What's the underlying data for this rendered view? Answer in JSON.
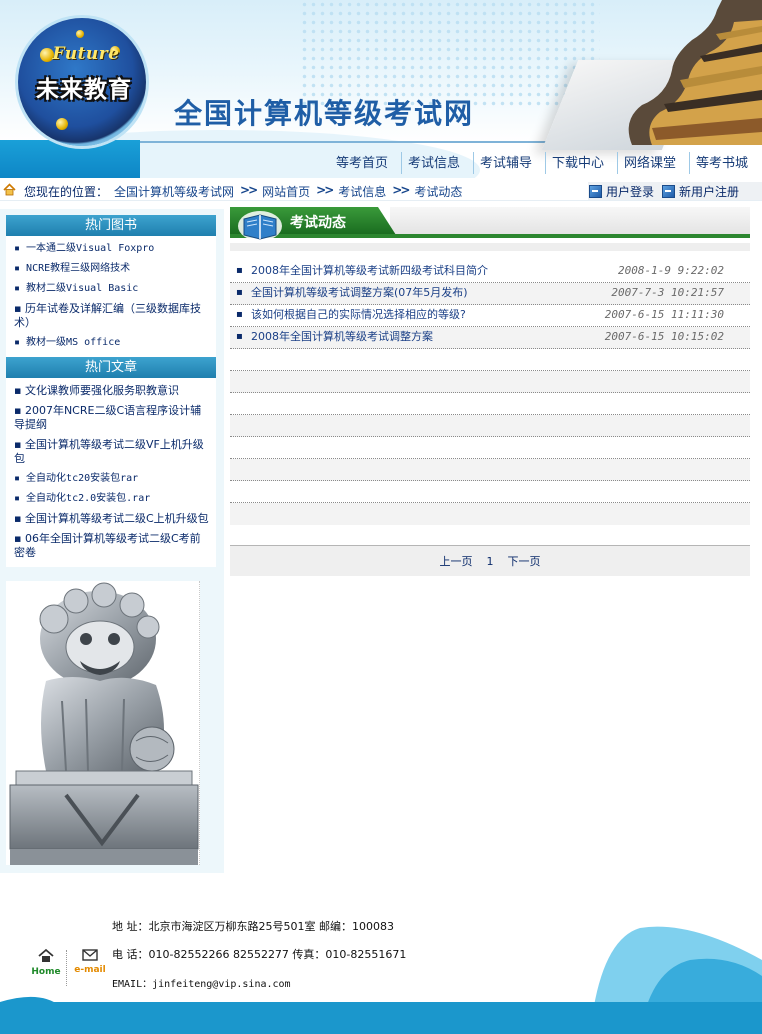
{
  "header": {
    "logo_en": "Future",
    "logo_cn": "未来教育",
    "site_title": "全国计算机等级考试网",
    "nav": [
      "等考首页",
      "试信息",
      "考试辅导",
      "下载中心",
      "网络课堂",
      "等考书城"
    ]
  },
  "breadcrumb": {
    "label": "您现在的位置：",
    "items": [
      "全国计算机等级考试网",
      "网站首页",
      "考试信息",
      "考试动态"
    ],
    "separator": ">>"
  },
  "user_links": {
    "login": "用户登录",
    "register": "新用户注册"
  },
  "sidebar": {
    "books": {
      "title": "热门图书",
      "items": [
        "一本通二级Visual Foxpro",
        "NCRE教程三级网络技术",
        "教材二级Visual Basic",
        "历年试卷及详解汇编（三级数据库技术）",
        "教材一级MS office"
      ]
    },
    "articles": {
      "title": "热门文章",
      "items": [
        "文化课教师要强化服务职教意识",
        "2007年NCRE二级C语言程序设计辅导提纲",
        "全国计算机等级考试二级VF上机升级包",
        "全自动化tc20安装包rar",
        "全自动化tc2.0安装包.rar",
        "全国计算机等级考试二级C上机升级包",
        "06年全国计算机等级考试二级C考前密卷"
      ]
    }
  },
  "main": {
    "section_title": "考试动态",
    "news": [
      {
        "title": "2008年全国计算机等级考试新四级考试科目简介",
        "date": "2008-1-9 9:22:02"
      },
      {
        "title": "全国计算机等级考试调整方案(07年5月发布)",
        "date": "2007-7-3 10:21:57"
      },
      {
        "title": "该如何根据自己的实际情况选择相应的等级?",
        "date": "2007-6-15 11:11:30"
      },
      {
        "title": "2008年全国计算机等级考试调整方案",
        "date": "2007-6-15 10:15:02"
      }
    ],
    "pager": {
      "prev": "上一页",
      "current": "1",
      "next": "下一页"
    }
  },
  "footer": {
    "address": "地 址：北京市海淀区万柳东路25号501室  邮编：100083",
    "phone": "电 话：010-82552266 82552277 传真：010-82551671",
    "email": "EMAIL：jinfeiteng@vip.sina.com",
    "home_label": "Home",
    "email_label": "e-mail"
  },
  "colors": {
    "nav_text": "#173c78",
    "section_green": "#2c862f",
    "sidebar_head": "#2a8fbf",
    "footer_blue": "#1b97cc"
  }
}
